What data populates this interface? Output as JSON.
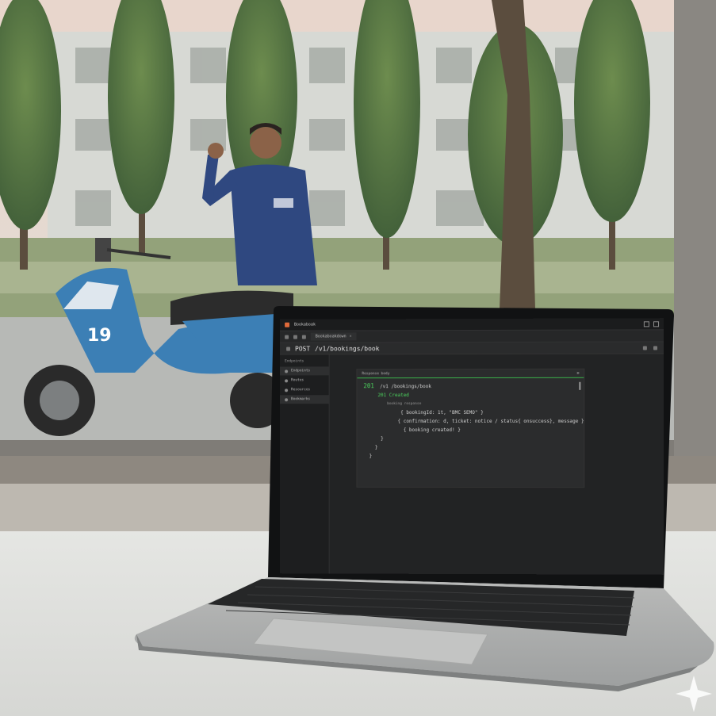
{
  "window": {
    "app_title": "Bookaboak"
  },
  "tab": {
    "label": "Bookaboakdown"
  },
  "request": {
    "method": "POST",
    "endpoint": "/v1/bookings/book"
  },
  "sidebar": {
    "header": "Endpoints",
    "items": [
      {
        "label": "Endpoints",
        "active": true
      },
      {
        "label": "Routes",
        "active": false
      },
      {
        "label": "Resources",
        "active": false
      },
      {
        "label": "Bookmarks",
        "active": true
      }
    ]
  },
  "response": {
    "panel_title": "Response body",
    "status_code": "201",
    "path": "/v1 /bookings/book",
    "status_text": "201 Created",
    "comment": "booking response",
    "lines": [
      "{ bookingId: 1t, \"BMC SEMO\" }",
      "{ confirmation: d, ticket: notice / status{ onsuccess}, message }",
      "{ booking created! }",
      "}",
      "}",
      "}"
    ]
  },
  "colors": {
    "accent": "#4cd35e",
    "screen_bg": "#222324"
  }
}
